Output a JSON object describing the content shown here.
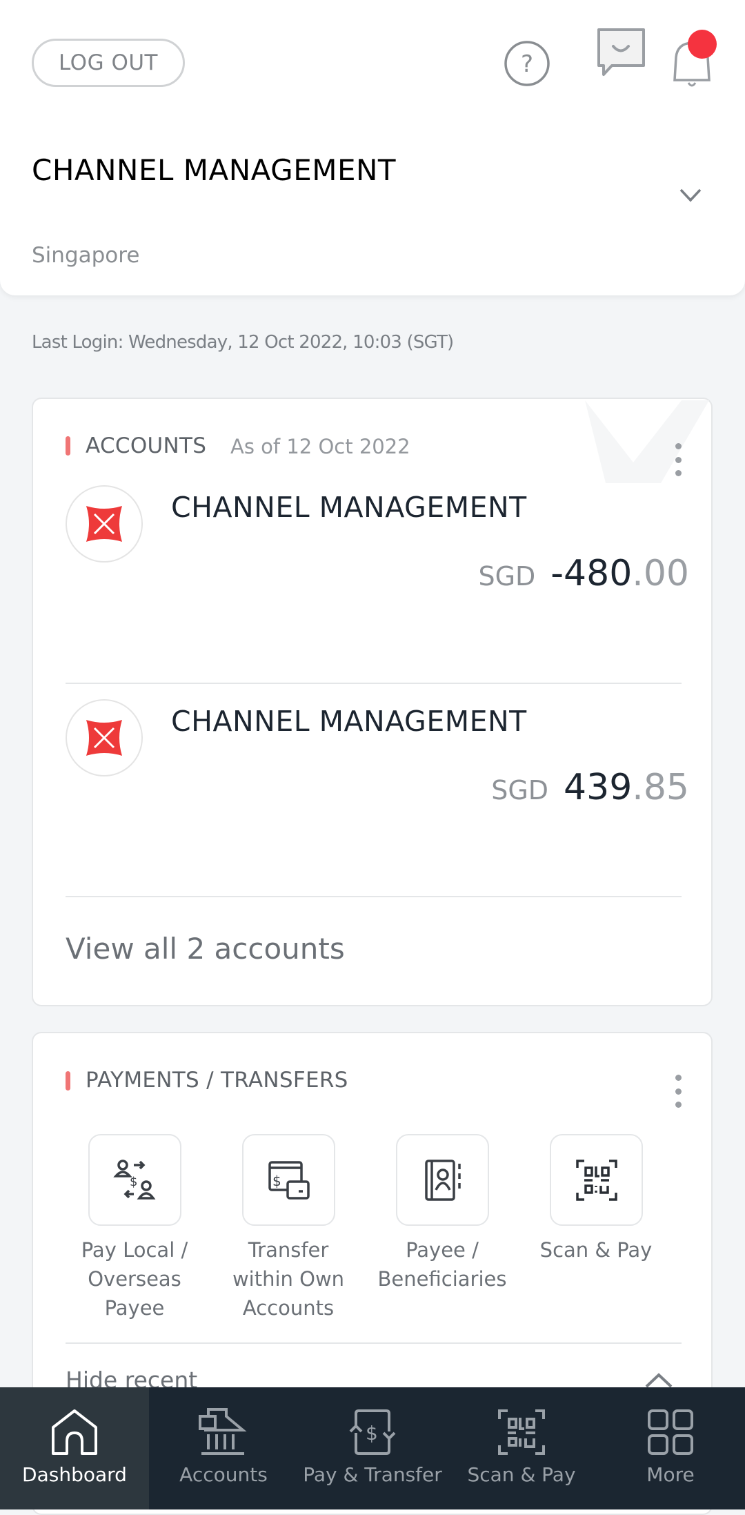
{
  "header": {
    "logout_label": "LOG OUT",
    "title": "CHANNEL MANAGEMENT",
    "country": "Singapore",
    "notification_dot_color": "#f5333f"
  },
  "last_login": "Last Login: Wednesday, 12 Oct 2022, 10:03 (SGT)",
  "accounts": {
    "title": "ACCOUNTS",
    "as_of": "As of 12 Oct 2022",
    "items": [
      {
        "name": "CHANNEL MANAGEMENT",
        "currency": "SGD",
        "amount_int": "-480",
        "amount_dec": ".00"
      },
      {
        "name": "CHANNEL MANAGEMENT",
        "currency": "SGD",
        "amount_int": "439",
        "amount_dec": ".85"
      }
    ],
    "view_all": "View all 2 accounts"
  },
  "payments": {
    "title": "PAYMENTS / TRANSFERS",
    "tiles": [
      {
        "label": "Pay Local / Overseas Payee",
        "icon": "pay-payee-icon"
      },
      {
        "label": "Transfer within Own Accounts",
        "icon": "transfer-own-icon"
      },
      {
        "label": "Payee / Beneficiaries",
        "icon": "address-book-icon"
      },
      {
        "label": "Scan & Pay",
        "icon": "qr-scan-icon"
      }
    ],
    "hide_recent": "Hide recent"
  },
  "nav": {
    "items": [
      {
        "label": "Dashboard",
        "icon": "home-icon",
        "active": true
      },
      {
        "label": "Accounts",
        "icon": "bank-icon"
      },
      {
        "label": "Pay & Transfer",
        "icon": "pay-transfer-icon"
      },
      {
        "label": "Scan & Pay",
        "icon": "qr-scan-icon"
      },
      {
        "label": "More",
        "icon": "grid-icon"
      }
    ]
  },
  "colors": {
    "accent_red": "#f07575",
    "nav_bg": "#1b2631",
    "logo_red": "#ee3a3a"
  }
}
